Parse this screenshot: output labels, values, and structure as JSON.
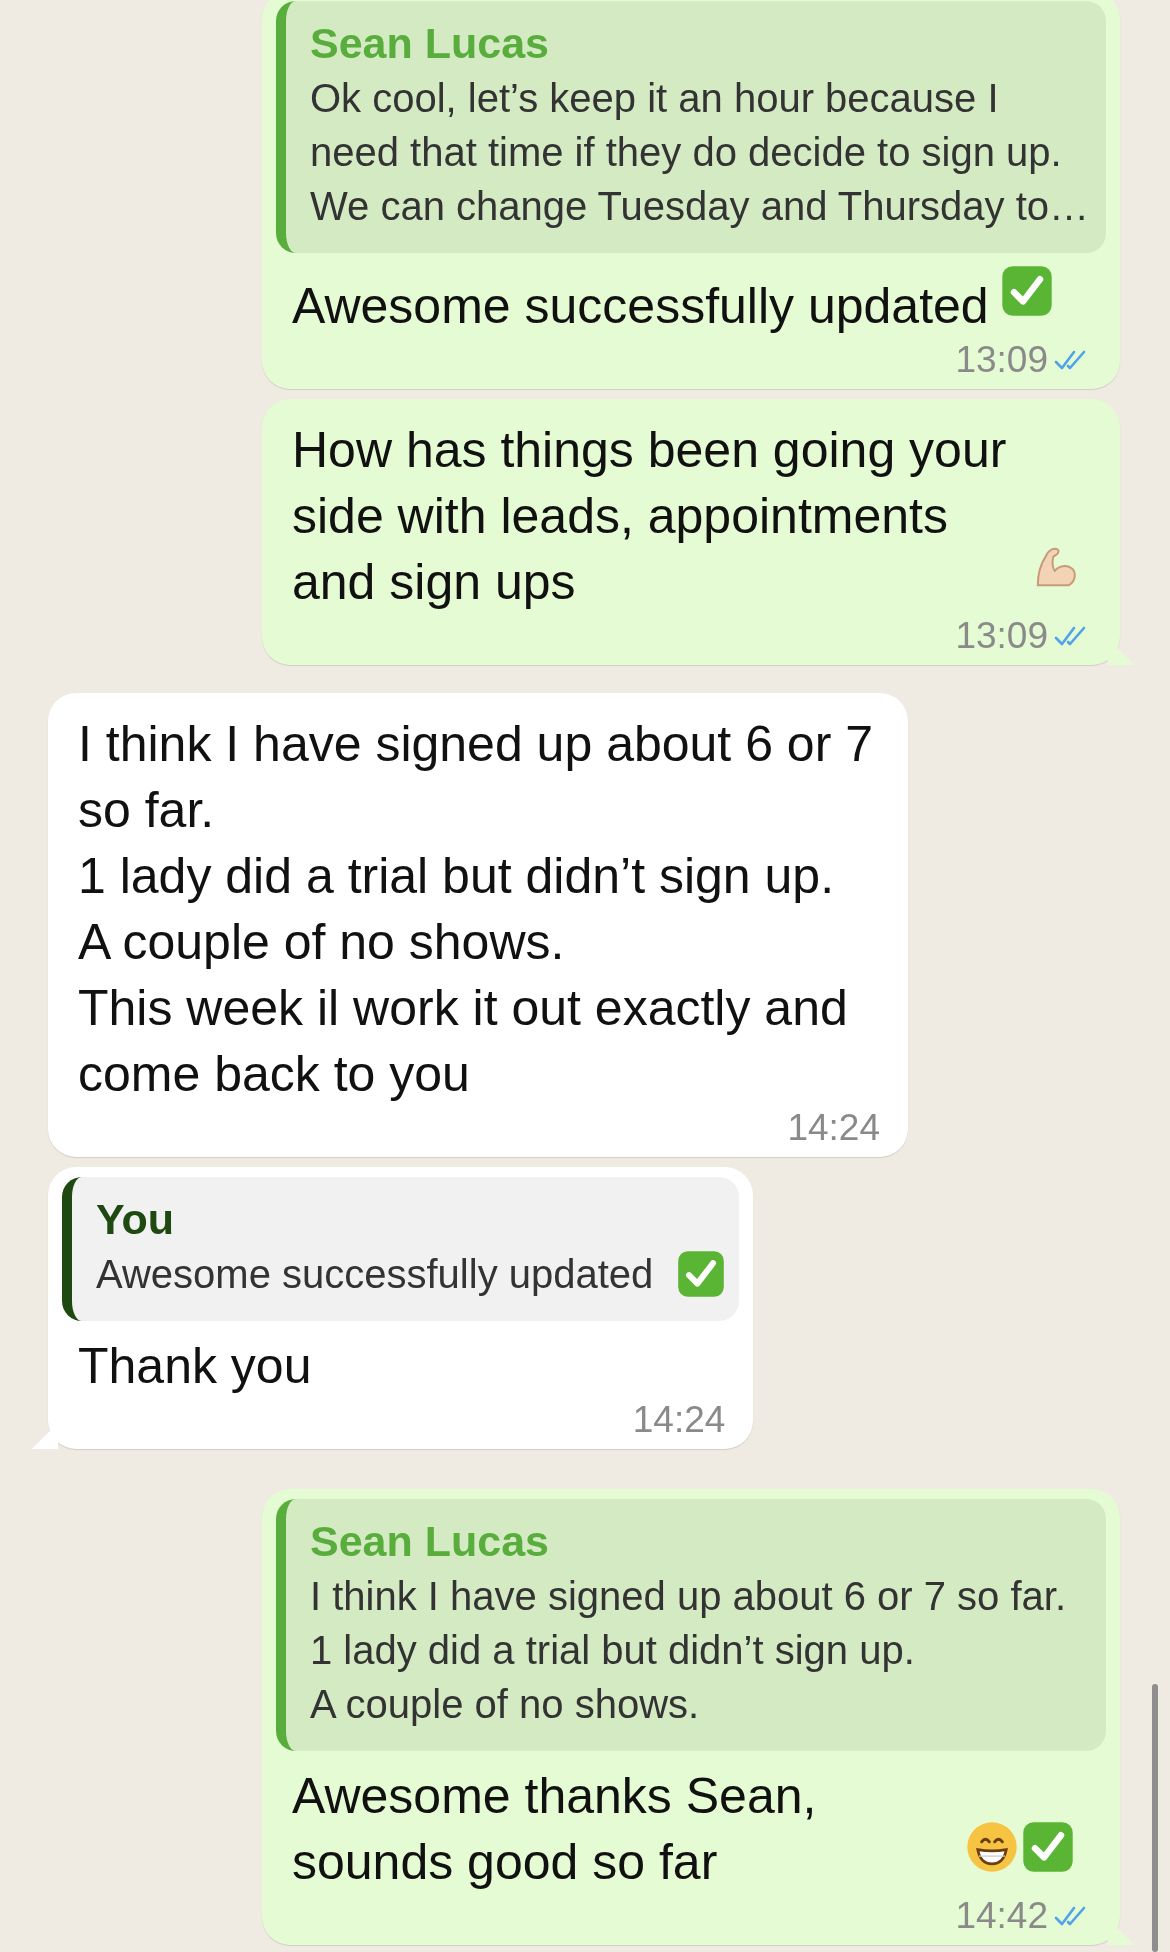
{
  "messages": [
    {
      "outgoing": true,
      "tail": false,
      "quote": {
        "author": "Sean Lucas",
        "color": "#58ad3c",
        "text": "Ok cool, let’s keep it an hour because I\nneed that time if they do decide to sign up.\nWe can change Tuesday and Thursday to…"
      },
      "text": "Awesome successfully updated",
      "emoji": [
        {
          "kind": "check"
        }
      ],
      "time": "13:09",
      "read": true
    },
    {
      "outgoing": true,
      "tail": true,
      "text": "How has things been going your side with leads, appointments and sign ups",
      "emoji": [
        {
          "kind": "flex"
        }
      ],
      "time": "13:09",
      "read": true
    },
    {
      "outgoing": false,
      "tail": false,
      "text": "I think I have signed up about 6 or 7 so far.\n1 lady did a trial but didn’t sign up.\nA couple of no shows.\nThis week il work it out exactly and come back to you",
      "time": "14:24"
    },
    {
      "outgoing": false,
      "tail": true,
      "quote": {
        "author": "You",
        "color": "#1e4a12",
        "text": "Awesome successfully updated",
        "emoji": [
          {
            "kind": "check"
          }
        ]
      },
      "text": "Thank you",
      "time": "14:24"
    },
    {
      "outgoing": true,
      "tail": true,
      "quote": {
        "author": "Sean Lucas",
        "color": "#58ad3c",
        "text": "I think I have signed up about 6 or 7 so far.\n1 lady did a trial but didn’t sign up.\nA couple of no shows."
      },
      "text": "Awesome thanks Sean, sounds good so far",
      "emoji": [
        {
          "kind": "grin"
        },
        {
          "kind": "check"
        }
      ],
      "time": "14:42",
      "read": true
    }
  ]
}
